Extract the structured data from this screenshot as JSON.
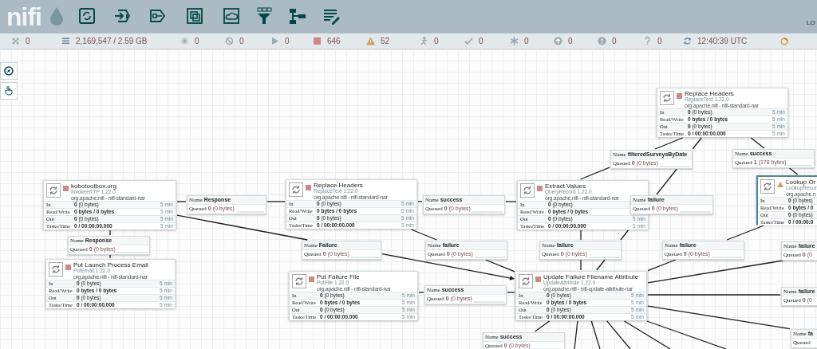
{
  "header": {
    "logo": "nifi",
    "user_text": "LO"
  },
  "status_bar": {
    "items": [
      "0",
      "2,169,547 / 2.59 GB",
      "0",
      "0",
      "0",
      "646",
      "52",
      "0",
      "0",
      "0",
      "0",
      "0",
      "0",
      "12:40:39 UTC"
    ]
  },
  "processors": [
    {
      "name": "Replace Headers",
      "type": "ReplaceText 1.22.0",
      "bundle": "org.apache.nifi - nifi-standard-nar",
      "kind": "stopped",
      "selected": false,
      "stats": [
        {
          "label": "In",
          "value": "**0** (0 bytes)",
          "window": "5 min"
        },
        {
          "label": "Read/Write",
          "value": "0 bytes / 0 bytes",
          "window": "5 min"
        },
        {
          "label": "Out",
          "value": "**0** (0 bytes)",
          "window": "5 min"
        },
        {
          "label": "Tasks/Time",
          "value": "0 / 00:00:00.000",
          "window": "5 min"
        }
      ]
    },
    {
      "name": "Lookup Or",
      "type": "LookupRecor",
      "bundle": "org.apache.n",
      "kind": "invalid",
      "selected": true,
      "stats": [
        {
          "label": "In",
          "value": "**0** (0 bytes)"
        },
        {
          "label": "Read/Write",
          "value": "0 bytes / 0"
        },
        {
          "label": "Out",
          "value": "**0** (0 bytes)"
        },
        {
          "label": "Tasks/Time",
          "value": "0 / 00:00:0"
        }
      ]
    },
    {
      "name": "kobotoolbox.org",
      "type": "InvokeHTTP 1.22.0",
      "bundle": "org.apache.nifi - nifi-standard-nar",
      "kind": "stopped",
      "selected": false,
      "stats": [
        {
          "label": "In",
          "value": "**0** (0 bytes)",
          "window": "5 min"
        },
        {
          "label": "Read/Write",
          "value": "0 bytes / 0 bytes",
          "window": "5 min"
        },
        {
          "label": "Out",
          "value": "**0** (0 bytes)",
          "window": "5 min"
        },
        {
          "label": "Tasks/Time",
          "value": "0 / 00:00:00.000",
          "window": "5 min"
        }
      ]
    },
    {
      "name": "Replace Headers",
      "type": "ReplaceText 1.22.0",
      "bundle": "org.apache.nifi - nifi-standard-nar",
      "kind": "stopped",
      "selected": false,
      "stats": [
        {
          "label": "In",
          "value": "**0** (0 bytes)",
          "window": "5 min"
        },
        {
          "label": "Read/Write",
          "value": "0 bytes / 0 bytes",
          "window": "5 min"
        },
        {
          "label": "Out",
          "value": "**0** (0 bytes)",
          "window": "5 min"
        },
        {
          "label": "Tasks/Time",
          "value": "0 / 00:00:00.000",
          "window": "5 min"
        }
      ]
    },
    {
      "name": "Extract Values",
      "type": "QueryRecord 1.22.0",
      "bundle": "org.apache.nifi - nifi-standard-nar",
      "kind": "stopped",
      "selected": false,
      "stats": [
        {
          "label": "In",
          "value": "**0** (0 bytes)"
        },
        {
          "label": "Read/Write",
          "value": "0 bytes / 0 bytes"
        },
        {
          "label": "Out",
          "value": "**0** (0 bytes)",
          "window": "5 min"
        },
        {
          "label": "Tasks/Time",
          "value": "0 / 00:00:00.000",
          "window": "5 min"
        }
      ]
    },
    {
      "name": "Put Launch Process Email",
      "type": "PutEmail 1.22.0",
      "bundle": "org.apache.nifi - nifi-standard-nar",
      "kind": "stopped",
      "selected": false,
      "stats": [
        {
          "label": "In",
          "value": "**0** (0 bytes)",
          "window": "5 min"
        },
        {
          "label": "Read/Write",
          "value": "0 bytes / 0 bytes",
          "window": "5 min"
        },
        {
          "label": "Out",
          "value": "**0** (0 bytes)",
          "window": "5 min"
        },
        {
          "label": "Tasks/Time",
          "value": "0 / 00:00:00.000",
          "window": "5 min"
        }
      ]
    },
    {
      "name": "Put Failure File",
      "type": "PutFile 1.22.0",
      "bundle": "org.apache.nifi - nifi-standard-nar",
      "kind": "stopped",
      "selected": false,
      "stats": [
        {
          "label": "In",
          "value": "**0** (0 bytes)",
          "window": "5 min"
        },
        {
          "label": "Read/Write",
          "value": "0 bytes / 0 bytes",
          "window": "5 min"
        },
        {
          "label": "Out",
          "value": "**0** (0 bytes)",
          "window": "5 min"
        },
        {
          "label": "Tasks/Time",
          "value": "0 / 00:00:00.000",
          "window": "5 min"
        }
      ]
    },
    {
      "name": "Update Failure Filename Attribute",
      "type": "UpdateAttribute 1.22.0",
      "bundle": "org.apache.nifi - nifi-update-attribute-nar",
      "kind": "stopped",
      "selected": false,
      "stats": [
        {
          "label": "In",
          "value": "**0** (0 bytes)",
          "window": "5 min"
        },
        {
          "label": "Read/Write",
          "value": "0 bytes / 0 bytes",
          "window": "5 min"
        },
        {
          "label": "Out",
          "value": "**0** (0 bytes)",
          "window": "5 min"
        },
        {
          "label": "Tasks/Time",
          "value": "0 / 00:00:00.000",
          "window": "5 min"
        }
      ]
    }
  ],
  "connections": [
    {
      "name_label": "Name",
      "name": "filteredSurveysByDate",
      "queued_label": "Queued",
      "queued": "**0** (0 bytes)"
    },
    {
      "name_label": "Name",
      "name": "success",
      "queued_label": "Queued",
      "queued": "**1** (178 bytes)"
    },
    {
      "name_label": "Name",
      "name": "Response",
      "queued_label": "Queued",
      "queued": "**0** (0 bytes)"
    },
    {
      "name_label": "Name",
      "name": "success",
      "queued_label": "Queued",
      "queued": "**0** (0 bytes)"
    },
    {
      "name_label": "Name",
      "name": "failure",
      "queued_label": "Queued",
      "queued": "**0** (0 bytes)"
    },
    {
      "name_label": "Name",
      "name": "Response",
      "queued_label": "Queued",
      "queued": "**0** (0 bytes)"
    },
    {
      "name_label": "Name",
      "name": "Failure",
      "queued_label": "Queued",
      "queued": "**0** (0 bytes)"
    },
    {
      "name_label": "Name",
      "name": "failure",
      "queued_label": "Queued",
      "queued": "**0** (0 bytes)"
    },
    {
      "name_label": "Name",
      "name": "failure",
      "queued_label": "Queued",
      "queued": "**0** (0 bytes)"
    },
    {
      "name_label": "Name",
      "name": "failure",
      "queued_label": "Queued",
      "queued": "**0** (0 bytes)"
    },
    {
      "name_label": "Name",
      "name": "failure",
      "queued_label": "Queued",
      "queued": "**0** (0"
    },
    {
      "name_label": "Name",
      "name": "success",
      "queued_label": "Queued",
      "queued": "**0** (0 bytes)"
    },
    {
      "name_label": "Name",
      "name": "failure",
      "queued_label": "Queued",
      "queued": "**0** (0"
    },
    {
      "name_label": "Name",
      "name": "success",
      "queued_label": "Queued",
      "queued": "**0** (0 bytes)"
    },
    {
      "name_label": "Name",
      "name": "fa",
      "queued_label": "Queued"
    }
  ]
}
